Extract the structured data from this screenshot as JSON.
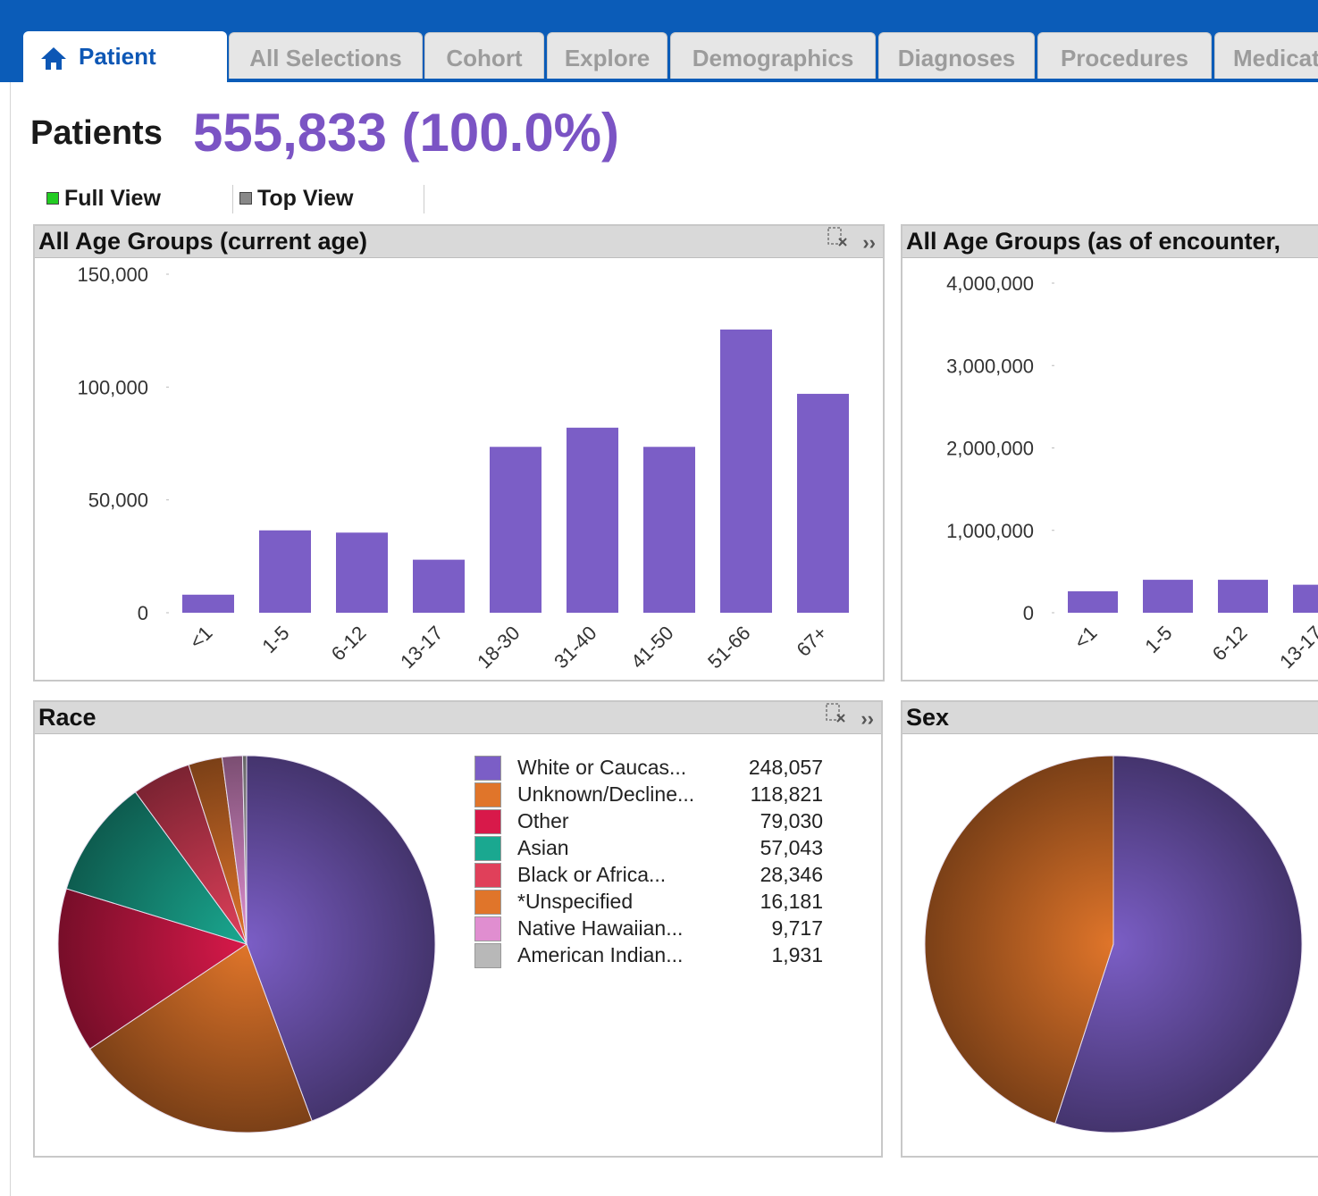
{
  "tabs": [
    {
      "label": "Patient",
      "active": true,
      "icon": "home-icon"
    },
    {
      "label": "All Selections"
    },
    {
      "label": "Cohort"
    },
    {
      "label": "Explore"
    },
    {
      "label": "Demographics"
    },
    {
      "label": "Diagnoses"
    },
    {
      "label": "Procedures"
    },
    {
      "label": "Medicat"
    }
  ],
  "summary": {
    "label": "Patients",
    "count": "555,833 (100.0%)"
  },
  "views": [
    {
      "label": "Full View",
      "color": "#22cc22"
    },
    {
      "label": "Top View",
      "color": "#888888"
    }
  ],
  "panels": {
    "age_current": {
      "title": "All Age Groups (current age)",
      "icons": [
        "clear-selection-icon",
        "expand-icon"
      ]
    },
    "age_encounter": {
      "title": "All Age Groups (as of encounter,"
    },
    "race": {
      "title": "Race",
      "icons": [
        "clear-selection-icon",
        "expand-icon"
      ]
    },
    "sex": {
      "title": "Sex"
    }
  },
  "chart_data": [
    {
      "type": "bar",
      "title": "All Age Groups (current age)",
      "categories": [
        "<1",
        "1-5",
        "6-12",
        "13-17",
        "18-30",
        "31-40",
        "41-50",
        "51-66",
        "67+"
      ],
      "values": [
        8000,
        36500,
        35500,
        23500,
        73500,
        82000,
        73500,
        125500,
        97000
      ],
      "y_ticks": [
        "150,000",
        "100,000",
        "50,000",
        "0"
      ],
      "ylim": [
        0,
        150000
      ],
      "color": "#7b5ec6"
    },
    {
      "type": "bar",
      "title": "All Age Groups (as of encounter,",
      "categories": [
        "<1",
        "1-5",
        "6-12",
        "13-17"
      ],
      "values": [
        260000,
        400000,
        400000,
        340000
      ],
      "y_ticks": [
        "4,000,000",
        "3,000,000",
        "2,000,000",
        "1,000,000",
        "0"
      ],
      "ylim": [
        0,
        4000000
      ],
      "color": "#7b5ec6"
    },
    {
      "type": "pie",
      "title": "Race",
      "categories": [
        "White or Caucas...",
        "Unknown/Decline...",
        "Other",
        "Asian",
        "Black or Africa...",
        "*Unspecified",
        "Native Hawaiian...",
        "American Indian..."
      ],
      "values": [
        248057,
        118821,
        79030,
        57043,
        28346,
        16181,
        9717,
        1931
      ],
      "value_labels": [
        "248,057",
        "118,821",
        "79,030",
        "57,043",
        "28,346",
        "16,181",
        "9,717",
        "1,931"
      ],
      "colors": [
        "#7b5ec6",
        "#e0752a",
        "#d8194a",
        "#1aa890",
        "#e0405a",
        "#e0752a",
        "#e08ed0",
        "#b8b8b8"
      ]
    },
    {
      "type": "pie",
      "title": "Sex",
      "values": [
        55,
        45
      ],
      "colors": [
        "#7b5ec6",
        "#e0752a",
        "#e08ed0"
      ]
    }
  ]
}
